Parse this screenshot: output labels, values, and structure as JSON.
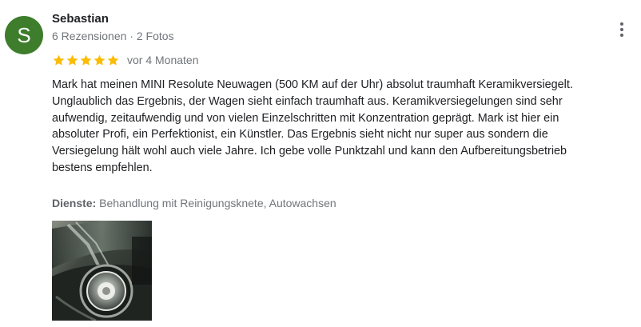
{
  "review": {
    "author": {
      "initial": "S",
      "name": "Sebastian",
      "meta": "6 Rezensionen · 2 Fotos",
      "avatar_color": "#3d7d2c"
    },
    "more_icon": "more-vert-icon",
    "rating": {
      "stars": 5,
      "max": 5,
      "star_color": "#fbbc04"
    },
    "date": "vor 4 Monaten",
    "text": "Mark hat meinen MINI Resolute Neuwagen (500 KM auf der Uhr) absolut traumhaft Keramikversiegelt.\nUnglaublich das Ergebnis, der Wagen sieht einfach traumhaft aus. Keramikversiegelungen sind sehr\naufwendig, zeitaufwendig und von vielen Einzelschritten mit Konzentration geprägt. Mark ist hier ein\nabsoluter Profi, ein Perfektionist, ein Künstler. Das Ergebnis sieht nicht nur super aus sondern die\nVersiegelung hält wohl auch viele Jahre. Ich gebe volle Punktzahl und kann den Aufbereitungsbetrieb\nbestens empfehlen.",
    "services": {
      "label": "Dienste:",
      "value": "Behandlung mit Reinigungsknete, Autowachsen"
    },
    "photo_icon": "car-headlight-photo"
  }
}
